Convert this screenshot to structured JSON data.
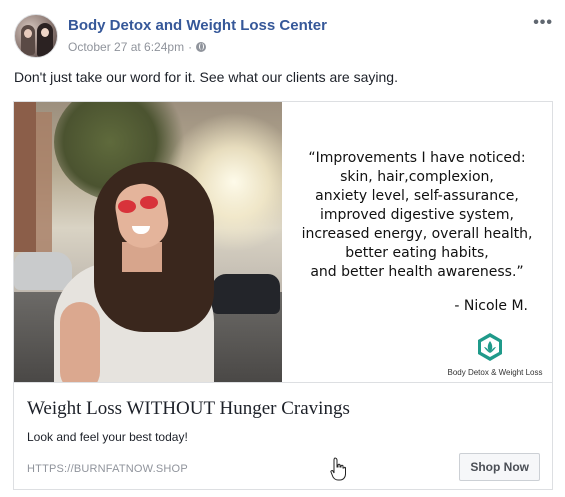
{
  "post": {
    "page_name": "Body Detox and Weight Loss Center",
    "timestamp": "October 27 at 6:24pm",
    "separator": "·",
    "privacy_icon": "globe-icon",
    "more_icon": "more-options-icon",
    "more_glyph": "•••",
    "text": "Don't just take our word for it. See what our clients are saying."
  },
  "ad": {
    "quote": "“Improvements I have noticed:\nskin, hair,complexion,\nanxiety level, self-assurance,\nimproved digestive system,\nincreased energy, overall health,\nbetter eating habits,\nand better health awareness.”",
    "author": "- Nicole M.",
    "logo_text": "Body Detox & Weight Loss",
    "headline": "Weight Loss WITHOUT Hunger Cravings",
    "description": "Look and feel your best today!",
    "domain": "HTTPS://BURNFATNOW.SHOP",
    "cta_label": "Shop Now"
  },
  "colors": {
    "page_name": "#365899",
    "meta": "#90949c",
    "logo_teal": "#1f9a8a"
  }
}
